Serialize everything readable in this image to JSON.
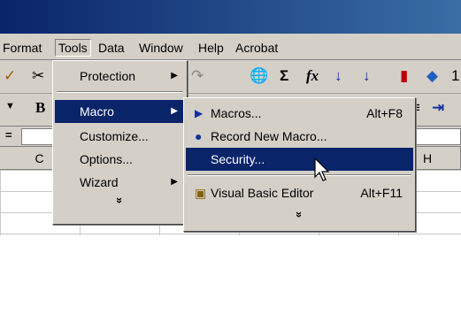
{
  "menubar": {
    "items": [
      "Format",
      "Tools",
      "Data",
      "Window",
      "Help",
      "Acrobat"
    ]
  },
  "toolbar": {
    "sigma": "Σ",
    "fx": "fx",
    "zoom_fragment": "1"
  },
  "columns": [
    "C",
    "H"
  ],
  "tools_menu": {
    "items": [
      {
        "label": "Protection",
        "submenu": true
      },
      {
        "label": "Macro",
        "submenu": true
      },
      {
        "label": "Customize...",
        "submenu": false
      },
      {
        "label": "Options...",
        "submenu": false
      },
      {
        "label": "Wizard",
        "submenu": true
      }
    ],
    "expand_label": "»"
  },
  "macro_menu": {
    "items": [
      {
        "label": "Macros...",
        "shortcut": "Alt+F8",
        "icon": "play-icon"
      },
      {
        "label": "Record New Macro...",
        "shortcut": "",
        "icon": "record-icon"
      },
      {
        "label": "Security...",
        "shortcut": "",
        "icon": ""
      },
      {
        "label": "Visual Basic Editor",
        "shortcut": "Alt+F11",
        "icon": "vb-editor-icon"
      }
    ],
    "expand_label": "»"
  },
  "colors": {
    "highlight": "#0a246a",
    "face": "#d4d0c8"
  }
}
